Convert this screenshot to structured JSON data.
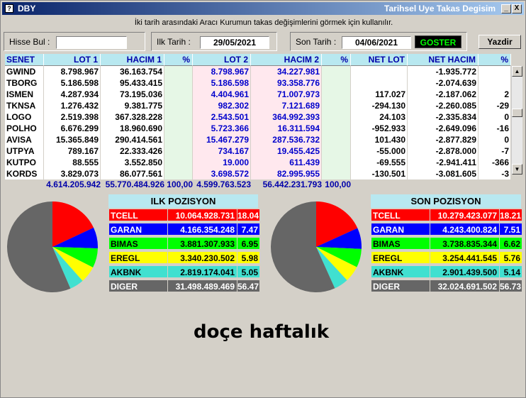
{
  "app": {
    "title": "DBY",
    "window_title": "Tarihsel Uye Takas Degisim",
    "sys_icon": "?",
    "minimize": "_",
    "close": "X"
  },
  "info_text": "İki tarih arasındaki  Aracı Kurumun takas değişimlerini görmek için kullanılır.",
  "search": {
    "label": "Hisse Bul :",
    "value": ""
  },
  "start_date": {
    "label": "Ilk Tarih :",
    "value": "29/05/2021"
  },
  "end_date": {
    "label": "Son Tarih :",
    "value": "04/06/2021"
  },
  "buttons": {
    "goster": "GOSTER",
    "yazdir": "Yazdir"
  },
  "table": {
    "headers": [
      "SENET",
      "LOT 1",
      "HACIM 1",
      "%",
      "LOT 2",
      "HACIM 2",
      "%",
      "NET LOT",
      "NET HACIM",
      "%"
    ],
    "rows": [
      [
        "GWIND",
        "8.798.967",
        "36.163.754",
        "",
        "8.798.967",
        "34.227.981",
        "",
        "",
        "-1.935.772",
        ""
      ],
      [
        "TBORG",
        "5.186.598",
        "95.433.415",
        "",
        "5.186.598",
        "93.358.776",
        "",
        "",
        "-2.074.639",
        ""
      ],
      [
        "ISMEN",
        "4.287.934",
        "73.195.036",
        "",
        "4.404.961",
        "71.007.973",
        "",
        "117.027",
        "-2.187.062",
        "2"
      ],
      [
        "TKNSA",
        "1.276.432",
        "9.381.775",
        "",
        "982.302",
        "7.121.689",
        "",
        "-294.130",
        "-2.260.085",
        "-29"
      ],
      [
        "LOGO",
        "2.519.398",
        "367.328.228",
        "",
        "2.543.501",
        "364.992.393",
        "",
        "24.103",
        "-2.335.834",
        "0"
      ],
      [
        "POLHO",
        "6.676.299",
        "18.960.690",
        "",
        "5.723.366",
        "16.311.594",
        "",
        "-952.933",
        "-2.649.096",
        "-16"
      ],
      [
        "AVISA",
        "15.365.849",
        "290.414.561",
        "",
        "15.467.279",
        "287.536.732",
        "",
        "101.430",
        "-2.877.829",
        "0"
      ],
      [
        "UTPYA",
        "789.167",
        "22.333.426",
        "",
        "734.167",
        "19.455.425",
        "",
        "-55.000",
        "-2.878.000",
        "-7"
      ],
      [
        "KUTPO",
        "88.555",
        "3.552.850",
        "",
        "19.000",
        "611.439",
        "",
        "-69.555",
        "-2.941.411",
        "-366"
      ],
      [
        "KORDS",
        "3.829.073",
        "86.077.561",
        "",
        "3.698.572",
        "82.995.955",
        "",
        "-130.501",
        "-3.081.605",
        "-3"
      ]
    ],
    "totals": {
      "lot1": "4.614.205.942",
      "hacim1": "55.770.484.926",
      "pct1": "100,00",
      "lot2": "4.599.763.523",
      "hacim2": "56.442.231.793",
      "pct2": "100,00"
    }
  },
  "ilk_pozisyon": {
    "title": "ILK POZISYON",
    "rows": [
      {
        "name": "TCELL",
        "value": "10.064.928.731",
        "pct": "18.04",
        "color": "#ff0000",
        "text": "#ffffff"
      },
      {
        "name": "GARAN",
        "value": "4.166.354.248",
        "pct": "7.47",
        "color": "#0000ff",
        "text": "#ffffff"
      },
      {
        "name": "BIMAS",
        "value": "3.881.307.933",
        "pct": "6.95",
        "color": "#00ff00",
        "text": "#000000"
      },
      {
        "name": "EREGL",
        "value": "3.340.230.502",
        "pct": "5.98",
        "color": "#ffff00",
        "text": "#000000"
      },
      {
        "name": "AKBNK",
        "value": "2.819.174.041",
        "pct": "5.05",
        "color": "#40e0d0",
        "text": "#000000"
      },
      {
        "name": "DIGER",
        "value": "31.498.489.469",
        "pct": "56.47",
        "color": "#666666",
        "text": "#ffffff"
      }
    ]
  },
  "son_pozisyon": {
    "title": "SON POZISYON",
    "rows": [
      {
        "name": "TCELL",
        "value": "10.279.423.077",
        "pct": "18.21",
        "color": "#ff0000",
        "text": "#ffffff"
      },
      {
        "name": "GARAN",
        "value": "4.243.400.824",
        "pct": "7.51",
        "color": "#0000ff",
        "text": "#ffffff"
      },
      {
        "name": "BIMAS",
        "value": "3.738.835.344",
        "pct": "6.62",
        "color": "#00ff00",
        "text": "#000000"
      },
      {
        "name": "EREGL",
        "value": "3.254.441.545",
        "pct": "5.76",
        "color": "#ffff00",
        "text": "#000000"
      },
      {
        "name": "AKBNK",
        "value": "2.901.439.500",
        "pct": "5.14",
        "color": "#40e0d0",
        "text": "#000000"
      },
      {
        "name": "DIGER",
        "value": "32.024.691.502",
        "pct": "56.73",
        "color": "#666666",
        "text": "#ffffff"
      }
    ]
  },
  "caption": "doçe haftalık"
}
